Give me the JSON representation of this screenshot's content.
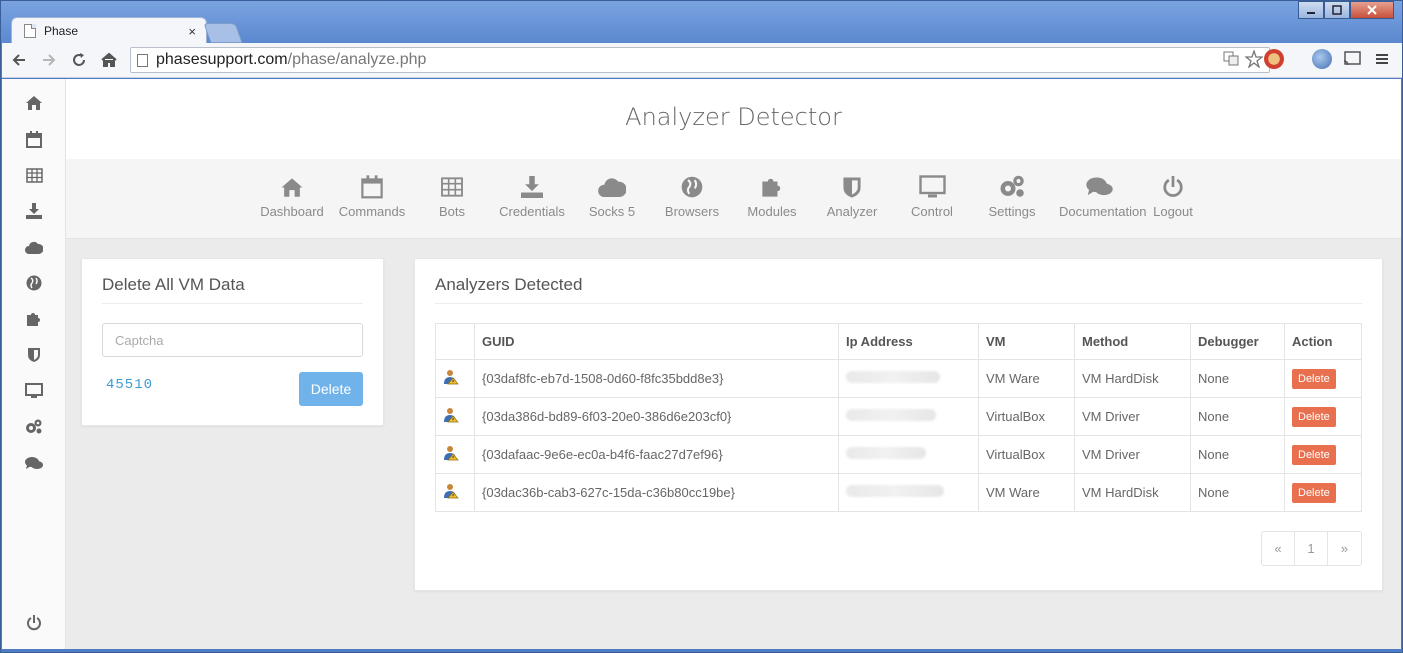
{
  "browser": {
    "tab_title": "Phase",
    "tab_close": "×",
    "url_host": "phasesupport.com",
    "url_path": "/phase/analyze.php",
    "window_controls": [
      "minimize",
      "maximize",
      "close"
    ]
  },
  "sidebar": {
    "icons": [
      "home-icon",
      "calendar-icon",
      "table-icon",
      "download-icon",
      "cloud-icon",
      "globe-icon",
      "puzzle-icon",
      "shield-icon",
      "monitor-icon",
      "gears-icon",
      "comments-icon"
    ],
    "logout_icon": "power-icon"
  },
  "header": {
    "title": "Analyzer Detector"
  },
  "nav": {
    "items": [
      {
        "label": "Dashboard",
        "icon": "home-icon"
      },
      {
        "label": "Commands",
        "icon": "calendar-icon"
      },
      {
        "label": "Bots",
        "icon": "table-icon"
      },
      {
        "label": "Credentials",
        "icon": "download-icon"
      },
      {
        "label": "Socks 5",
        "icon": "cloud-icon"
      },
      {
        "label": "Browsers",
        "icon": "globe-icon"
      },
      {
        "label": "Modules",
        "icon": "puzzle-icon"
      },
      {
        "label": "Analyzer",
        "icon": "shield-icon"
      },
      {
        "label": "Control",
        "icon": "monitor-icon"
      },
      {
        "label": "Settings",
        "icon": "gears-icon"
      },
      {
        "label": "Documentation",
        "icon": "comments-icon"
      },
      {
        "label": "Logout",
        "icon": "power-icon"
      }
    ]
  },
  "delete_panel": {
    "title": "Delete All VM Data",
    "captcha_placeholder": "Captcha",
    "captcha_value": "",
    "captcha_code": "45510",
    "delete_label": "Delete",
    "button_color": "#6fb3ea"
  },
  "analyzers_panel": {
    "title": "Analyzers Detected",
    "columns": [
      "",
      "GUID",
      "Ip Address",
      "VM",
      "Method",
      "Debugger",
      "Action"
    ],
    "rows": [
      {
        "guid": "{03daf8fc-eb7d-1508-0d60-f8fc35bdd8e3}",
        "ip": "",
        "vm": "VM Ware",
        "method": "VM HardDisk",
        "debugger": "None",
        "action": "Delete"
      },
      {
        "guid": "{03da386d-bd89-6f03-20e0-386d6e203cf0}",
        "ip": "",
        "vm": "VirtualBox",
        "method": "VM Driver",
        "debugger": "None",
        "action": "Delete"
      },
      {
        "guid": "{03dafaac-9e6e-ec0a-b4f6-faac27d7ef96}",
        "ip": "",
        "vm": "VirtualBox",
        "method": "VM Driver",
        "debugger": "None",
        "action": "Delete"
      },
      {
        "guid": "{03dac36b-cab3-627c-15da-c36b80cc19be}",
        "ip": "",
        "vm": "VM Ware",
        "method": "VM HardDisk",
        "debugger": "None",
        "action": "Delete"
      }
    ],
    "pagination": {
      "prev": "«",
      "page": "1",
      "next": "»"
    },
    "action_color": "#e8704f"
  }
}
